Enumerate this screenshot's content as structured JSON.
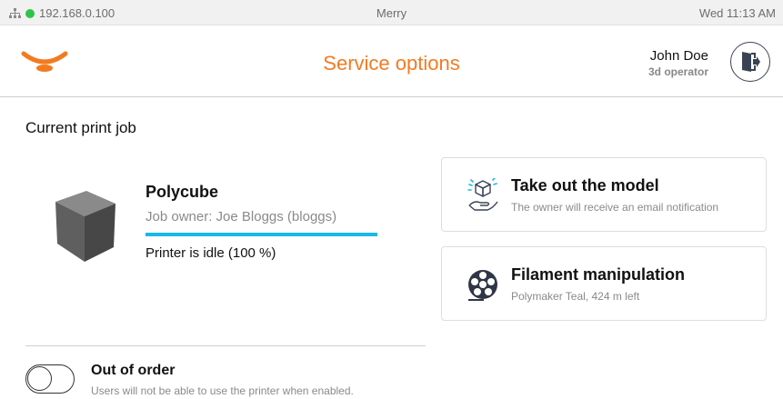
{
  "statusbar": {
    "ip": "192.168.0.100",
    "printer_name": "Merry",
    "datetime": "Wed 11:13 AM",
    "connection_color": "#2ec44a"
  },
  "header": {
    "title": "Service options",
    "user_name": "John Doe",
    "user_role": "3d operator",
    "accent_color": "#f47a20"
  },
  "job": {
    "section_title": "Current print job",
    "name": "Polycube",
    "owner": "Job owner: Joe Bloggs (bloggs)",
    "status": "Printer is idle (100 %)",
    "progress_percent": 100
  },
  "actions": [
    {
      "title": "Take out the model",
      "subtitle": "The owner will receive an email notification",
      "icon": "hand-cube-icon"
    },
    {
      "title": "Filament manipulation",
      "subtitle": "Polymaker Teal, 424 m left",
      "icon": "filament-spool-icon"
    }
  ],
  "out_of_order": {
    "title": "Out of order",
    "subtitle": "Users will not be able to use the printer when enabled.",
    "enabled": false
  }
}
